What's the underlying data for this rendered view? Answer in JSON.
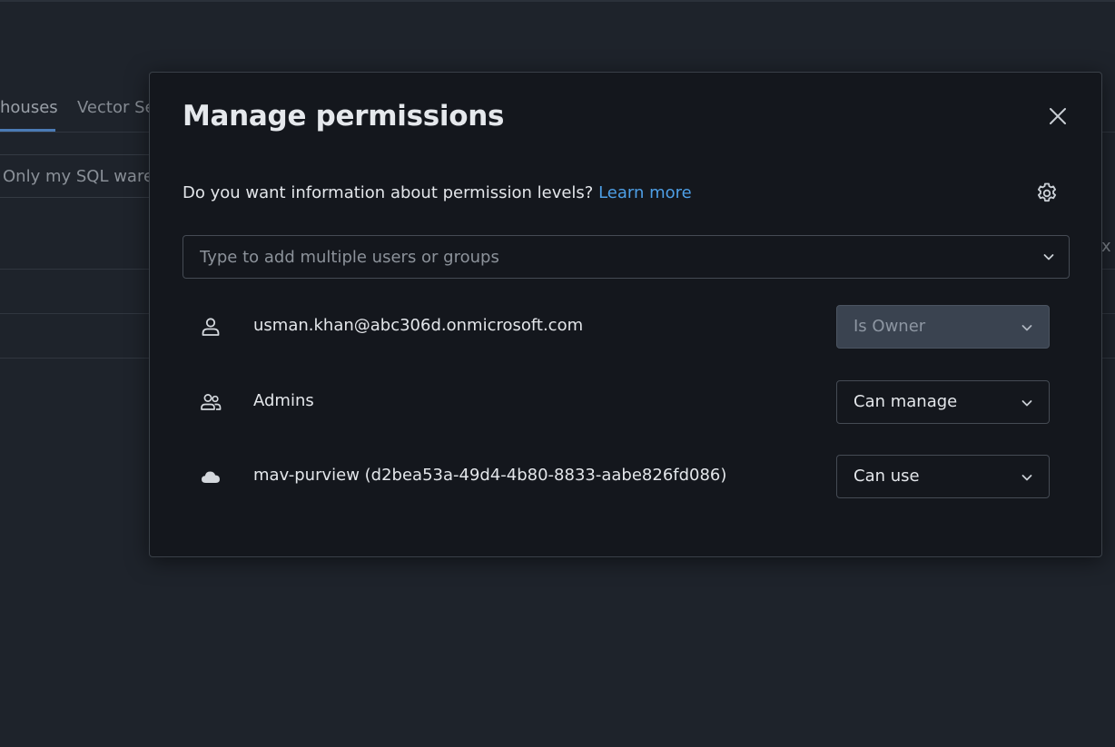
{
  "background": {
    "tabs": [
      {
        "label": "houses"
      },
      {
        "label": "Vector Se"
      }
    ],
    "filter_label": "Only my SQL warel",
    "edge_x": "x"
  },
  "modal": {
    "title": "Manage permissions",
    "info_text": "Do you want information about permission levels?",
    "learn_more": "Learn more",
    "search_placeholder": "Type to add multiple users or groups",
    "entries": [
      {
        "icon": "user-icon",
        "name": "usman.khan@abc306d.onmicrosoft.com",
        "permission": "Is Owner",
        "disabled": true
      },
      {
        "icon": "group-icon",
        "name": "Admins",
        "permission": "Can manage",
        "disabled": false
      },
      {
        "icon": "cloud-icon",
        "name": "mav-purview (d2bea53a-49d4-4b80-8833-aabe826fd086)",
        "permission": "Can use",
        "disabled": false
      }
    ]
  },
  "colors": {
    "accent_link": "#4e9fe6",
    "modal_bg": "#14171d",
    "page_bg": "#1e232b"
  }
}
